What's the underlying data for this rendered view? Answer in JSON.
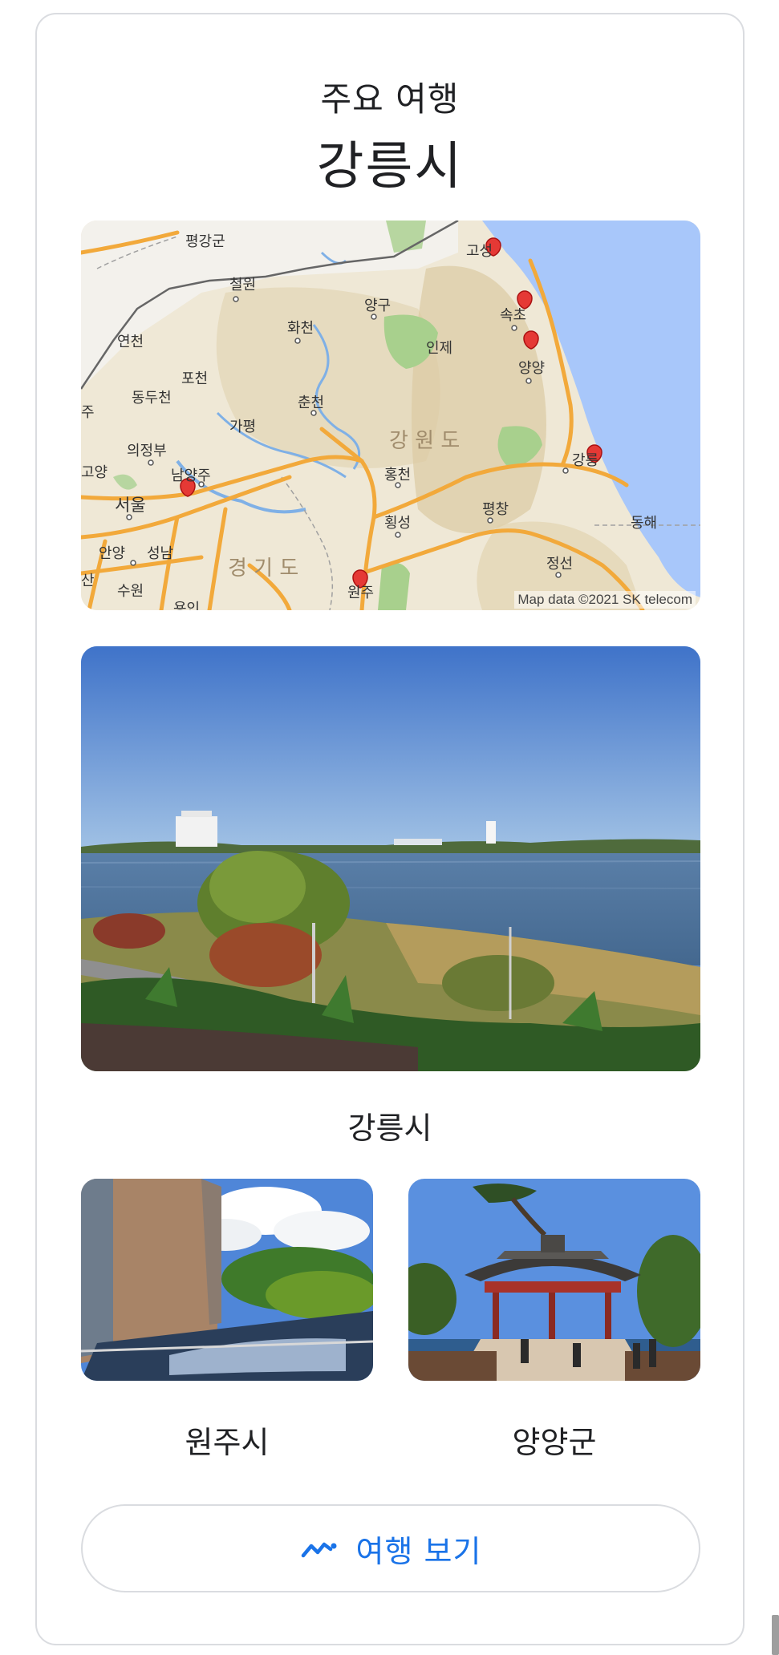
{
  "header": {
    "subtitle": "주요 여행",
    "title": "강릉시"
  },
  "map": {
    "credit": "Map data ©2021 SK telecom",
    "region_labels": [
      "강 원 도",
      "경 기 도"
    ],
    "place_labels": {
      "pyeonggang": "평강군",
      "cheorwon": "철원",
      "yanggu": "양구",
      "goseong": "고성",
      "sokcho": "속초",
      "inje": "인제",
      "yangyang": "양양",
      "yeoncheon": "연천",
      "hwacheon": "화천",
      "pocheon": "포천",
      "dongducheon": "동두천",
      "chuncheon": "춘천",
      "gapyeong": "가평",
      "uijeongbu": "의정부",
      "namyangju": "남양주",
      "goyang": "고양",
      "hongcheon": "홍천",
      "gangneung": "강릉",
      "seoul": "서울",
      "hoengseong": "횡성",
      "pyeongchang": "평창",
      "donghae": "동해",
      "anyang": "안양",
      "seongnam": "성남",
      "wonju": "원주",
      "jeongseon": "정선",
      "suwon": "수원",
      "yongin": "용인",
      "paju": "주",
      "hwaseong": "산"
    }
  },
  "destinations": {
    "main": {
      "name": "강릉시"
    },
    "secondary": [
      {
        "name": "원주시"
      },
      {
        "name": "양양군"
      }
    ]
  },
  "action": {
    "label": "여행 보기",
    "icon": "trending-route-icon"
  },
  "colors": {
    "accent": "#1a73e8",
    "border": "#dadce0",
    "map_land": "#efe8d6",
    "map_water": "#a8c7fa",
    "map_road": "#f2a93b",
    "marker": "#e53935"
  }
}
